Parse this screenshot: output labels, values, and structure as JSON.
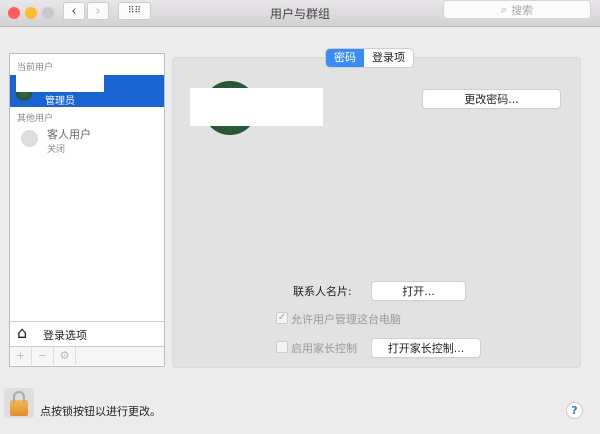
{
  "window": {
    "title": "用户与群组",
    "search_placeholder": "搜索"
  },
  "sidebar": {
    "current_users_header": "当前用户",
    "current_user": {
      "role": "管理员"
    },
    "other_users_header": "其他用户",
    "guest": {
      "name": "客人用户",
      "status": "关闭"
    },
    "login_options": "登录选项",
    "add": "+",
    "remove": "−",
    "gear": "⚙"
  },
  "tabs": [
    {
      "label": "密码",
      "active": true
    },
    {
      "label": "登录项",
      "active": false
    }
  ],
  "main": {
    "change_password": "更改密码...",
    "contact_card_label": "联系人名片:",
    "contact_card_button": "打开...",
    "allow_admin": {
      "label": "允许用户管理这台电脑",
      "checked": true
    },
    "parental": {
      "label": "启用家长控制",
      "checked": false
    },
    "parental_button": "打开家长控制..."
  },
  "footer": {
    "lock_text": "点按锁按钮以进行更改。",
    "help": "?"
  },
  "colors": {
    "accent": "#1a64d2"
  }
}
